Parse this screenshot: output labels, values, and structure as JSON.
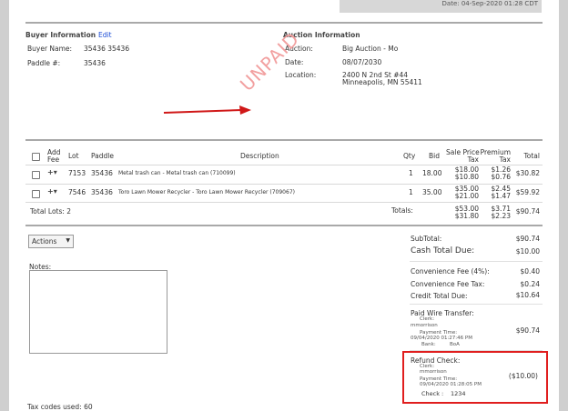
{
  "header": {
    "date_text": "Date: 04-Sep-2020 01:28 CDT"
  },
  "buyer": {
    "heading": "Buyer Information",
    "edit_label": "Edit",
    "name_label": "Buyer Name:",
    "name_value": "35436 35436",
    "paddle_label": "Paddle #:",
    "paddle_value": "35436"
  },
  "auction": {
    "heading": "Auction Information",
    "auction_label": "Auction:",
    "auction_value": "Big Auction - Mo",
    "date_label": "Date:",
    "date_value": "08/07/2030",
    "location_label": "Location:",
    "location_line1": "2400 N 2nd St #44",
    "location_line2": "Minneapolis, MN 55411"
  },
  "stamp": "UNPAID",
  "table": {
    "headers": {
      "add_fee_1": "Add",
      "add_fee_2": "Fee",
      "lot": "Lot",
      "paddle": "Paddle",
      "description": "Description",
      "qty": "Qty",
      "bid": "Bid",
      "sale_price_1": "Sale Price",
      "sale_price_2": "Tax",
      "premium_1": "Premium",
      "premium_2": "Tax",
      "total": "Total"
    },
    "rows": [
      {
        "fee": "+▾",
        "lot": "7153",
        "paddle": "35436",
        "description": "Metal trash can - Metal trash can (710099)",
        "qty": "1",
        "bid": "18.00",
        "sale_price": "$18.00",
        "sale_tax": "$10.80",
        "premium": "$1.26",
        "premium_tax": "$0.76",
        "total": "$30.82"
      },
      {
        "fee": "+▾",
        "lot": "7546",
        "paddle": "35436",
        "description": "Toro Lawn Mower Recycler - Toro Lawn Mower Recycler (709067)",
        "qty": "1",
        "bid": "35.00",
        "sale_price": "$35.00",
        "sale_tax": "$21.00",
        "premium": "$2.45",
        "premium_tax": "$1.47",
        "total": "$59.92"
      }
    ],
    "total_lots": "Total Lots: 2",
    "totals_label": "Totals:",
    "totals": {
      "sale_price": "$53.00",
      "sale_tax": "$31.80",
      "premium": "$3.71",
      "premium_tax": "$2.23",
      "total": "$90.74"
    }
  },
  "actions": {
    "label": "Actions",
    "notes_label": "Notes:",
    "tax_codes": "Tax codes used: 60"
  },
  "summary": {
    "subtotal_label": "SubTotal:",
    "subtotal_value": "$90.74",
    "cash_label": "Cash Total Due:",
    "cash_value": "$10.00",
    "conv_fee_label": "Convenience Fee (4%):",
    "conv_fee_value": "$0.40",
    "conv_tax_label": "Convenience Fee Tax:",
    "conv_tax_value": "$0.24",
    "credit_label": "Credit Total Due:",
    "credit_value": "$10.64",
    "wire": {
      "label": "Paid Wire Transfer:",
      "clerk_label": "Clerk:",
      "clerk_value": "mmorrison",
      "time_label": "Payment Time:",
      "time_value": "09/04/2020 01:27:46 PM",
      "bank_label": "Bank:",
      "bank_value": "BoA",
      "amount": "$90.74"
    },
    "refund": {
      "label": "Refund Check:",
      "clerk_label": "Clerk:",
      "clerk_value": "mmorrison",
      "time_label": "Payment Time:",
      "time_value": "09/04/2020 01:28:05 PM",
      "check_label": "Check :",
      "check_value": "1234",
      "amount": "($10.00)"
    }
  },
  "colors": {
    "stamp": "#f2a0a0",
    "highlight": "#e01e1e",
    "link": "#1a4bd6"
  }
}
